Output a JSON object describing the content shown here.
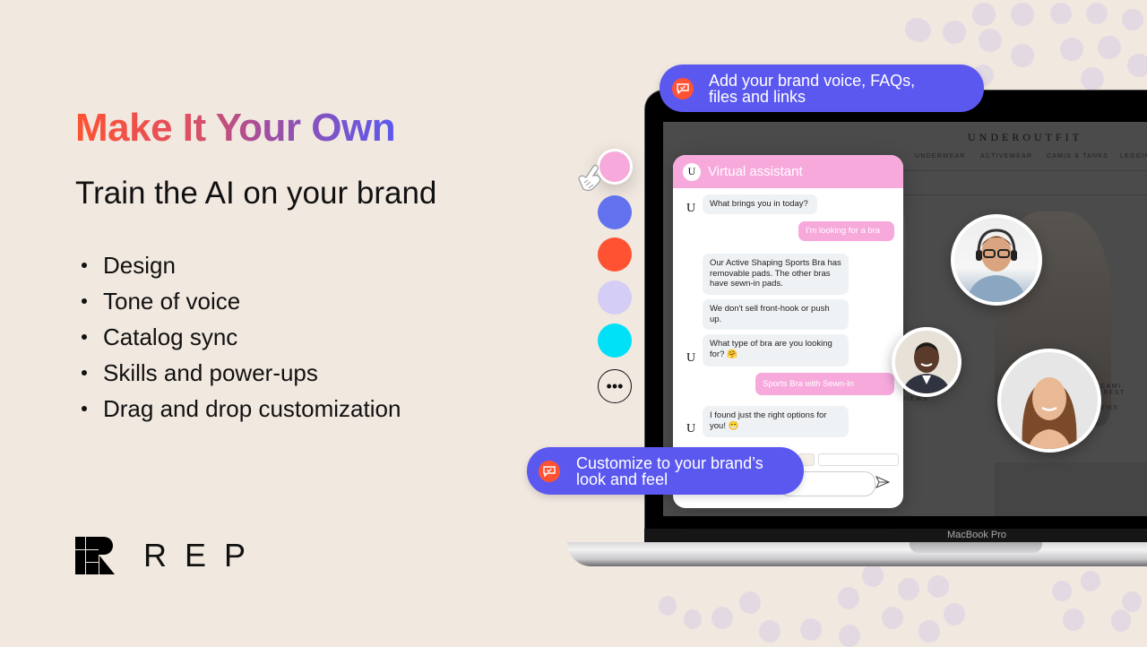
{
  "headline": "Make It Your Own",
  "subhead": "Train the AI on your brand",
  "features": [
    "Design",
    "Tone of voice",
    "Catalog sync",
    "Skills and power-ups",
    "Drag and drop customization"
  ],
  "logo": {
    "wordmark": "REP",
    "icon": "rep-logo-icon"
  },
  "colors": {
    "background": "#f1e8e0",
    "headline_gradient": [
      "#ff5233",
      "#5b58f0"
    ],
    "callout": "#5b58f0",
    "callout_icon": "#ff5233",
    "chat_header": "#f7a9dc"
  },
  "swatches": [
    {
      "name": "pink",
      "color": "#f7a9dc",
      "selected": true
    },
    {
      "name": "blue",
      "color": "#6272ee",
      "selected": false
    },
    {
      "name": "orange",
      "color": "#ff5233",
      "selected": false
    },
    {
      "name": "lavender",
      "color": "#d4cdf6",
      "selected": false
    },
    {
      "name": "cyan",
      "color": "#00e1f7",
      "selected": false
    }
  ],
  "more_swatches_label": "•••",
  "callouts": {
    "top": {
      "line1": "Add your brand voice, FAQs,",
      "line2": "files and links",
      "icon": "chat-check-icon"
    },
    "bottom": {
      "line1": "Customize to your brand’s",
      "line2": "look and feel",
      "icon": "chat-check-icon"
    }
  },
  "laptop": {
    "label": "MacBook Pro"
  },
  "store": {
    "brand": "UNDEROUTFIT",
    "nav": [
      "UNDERWEAR",
      "ACTIVEWEAR",
      "CAMIS & TANKS",
      "LEGGIN"
    ],
    "caption1": "CAMI [BEST",
    "caption2": "EWS",
    "caption3": "VIEWS"
  },
  "chat": {
    "title": "Virtual assistant",
    "logo_letter": "U",
    "messages": [
      {
        "from": "bot",
        "text": "What brings you in today?"
      },
      {
        "from": "user",
        "text": "I'm looking for a bra"
      },
      {
        "from": "bot",
        "text": "Our Active Shaping Sports Bra has removable pads. The other bras have sewn-in pads."
      },
      {
        "from": "bot",
        "text": "We don't sell front-hook or push up."
      },
      {
        "from": "bot",
        "text": "What type of bra are you looking for? 🤗"
      },
      {
        "from": "user",
        "text": "Sports Bra with Sewn-In"
      },
      {
        "from": "bot",
        "text": "I found just the right options for you! 😁"
      }
    ],
    "input_placeholder": ""
  },
  "agents": [
    {
      "name": "agent-headset-man"
    },
    {
      "name": "agent-man-suit"
    },
    {
      "name": "agent-woman"
    }
  ]
}
